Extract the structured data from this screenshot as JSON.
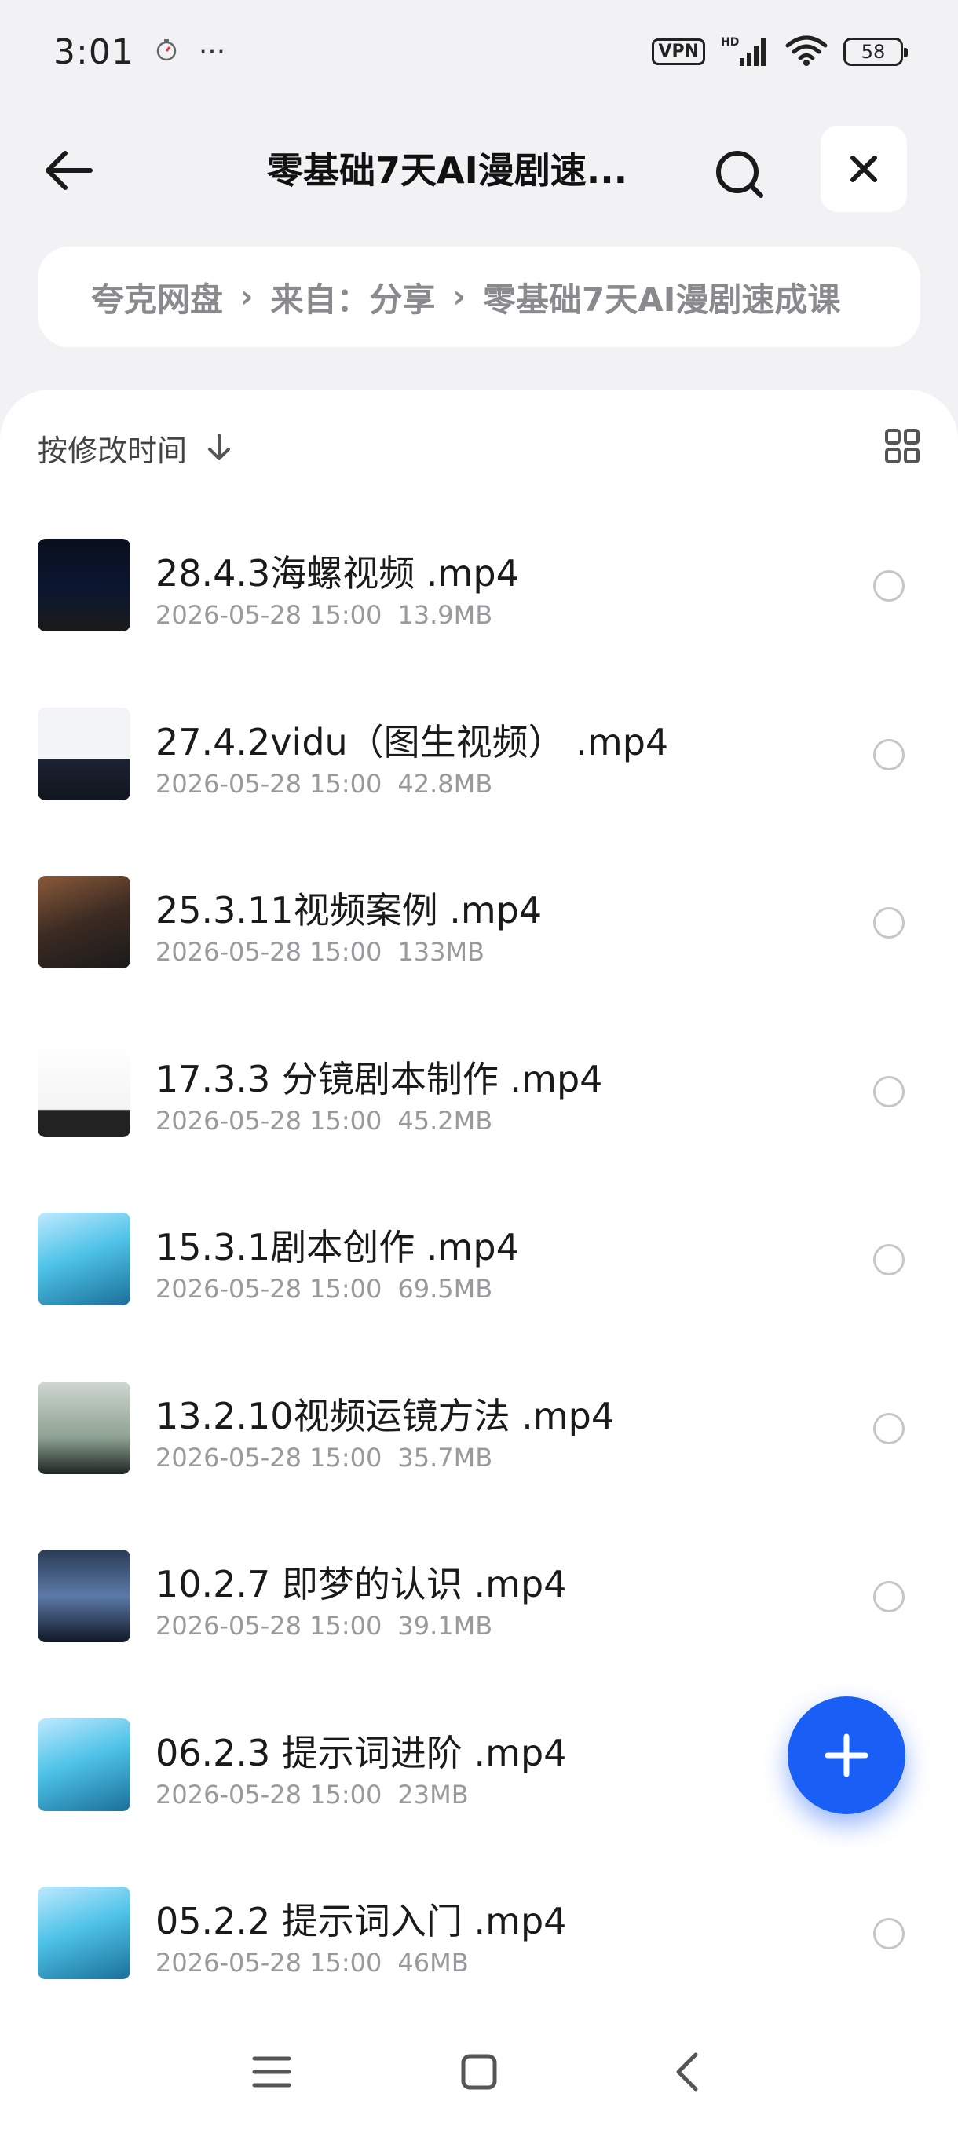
{
  "status_bar": {
    "time": "3:01",
    "dots": "···",
    "vpn": "VPN",
    "network": "HD",
    "battery": "58"
  },
  "header": {
    "title": "零基础7天AI漫剧速..."
  },
  "breadcrumb": {
    "items": [
      "夸克网盘",
      "来自：分享",
      "零基础7天AI漫剧速成课"
    ]
  },
  "sort": {
    "label": "按修改时间"
  },
  "files": [
    {
      "name": "28.4.3海螺视频 .mp4",
      "date": "2026-05-28 15:00",
      "size": "13.9MB"
    },
    {
      "name": "27.4.2vidu（图生视频） .mp4",
      "date": "2026-05-28 15:00",
      "size": "42.8MB"
    },
    {
      "name": "25.3.11视频案例 .mp4",
      "date": "2026-05-28 15:00",
      "size": "133MB"
    },
    {
      "name": "17.3.3 分镜剧本制作 .mp4",
      "date": "2026-05-28 15:00",
      "size": "45.2MB"
    },
    {
      "name": "15.3.1剧本创作 .mp4",
      "date": "2026-05-28 15:00",
      "size": "69.5MB"
    },
    {
      "name": "13.2.10视频运镜方法 .mp4",
      "date": "2026-05-28 15:00",
      "size": "35.7MB"
    },
    {
      "name": "10.2.7 即梦的认识 .mp4",
      "date": "2026-05-28 15:00",
      "size": "39.1MB"
    },
    {
      "name": "06.2.3 提示词进阶 .mp4",
      "date": "2026-05-28 15:00",
      "size": "23MB"
    },
    {
      "name": "05.2.2 提示词入门 .mp4",
      "date": "2026-05-28 15:00",
      "size": "46MB"
    }
  ],
  "colors": {
    "accent": "#1a5ff5",
    "background": "#f2f2f4",
    "meta_text": "#9a9a9e"
  }
}
